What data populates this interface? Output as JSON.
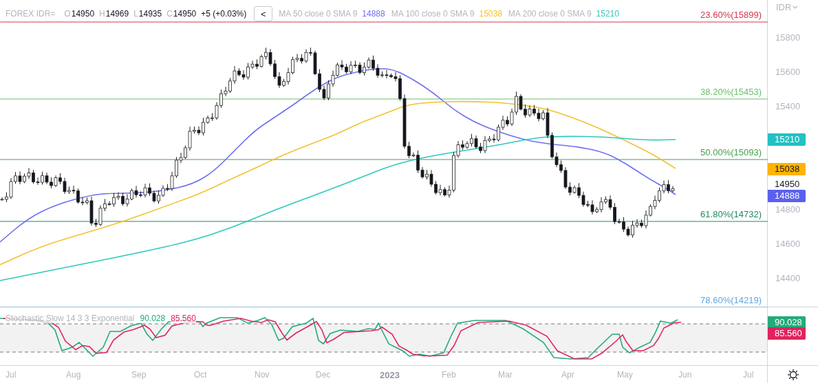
{
  "header": {
    "symbol": "FOREX IDR=",
    "ohlc": [
      {
        "label": "O",
        "value": "14950"
      },
      {
        "label": "H",
        "value": "14969"
      },
      {
        "label": "L",
        "value": "14935"
      },
      {
        "label": "C",
        "value": "14950"
      }
    ],
    "change": "+5 (+0.03%)",
    "collapse_button": "<"
  },
  "moving_averages": [
    {
      "label": "MA 50 close 0 SMA 9",
      "value": "14888",
      "color": "#6c6ff0"
    },
    {
      "label": "MA 100 close 0 SMA 9",
      "value": "15038",
      "color": "#f2c230"
    },
    {
      "label": "MA 200 close 0 SMA 9",
      "value": "15210",
      "color": "#2ec8c0"
    }
  ],
  "fibonacci_levels": [
    {
      "label": "23.60%(15899)",
      "color": "#d2364f"
    },
    {
      "label": "38.20%(15453)",
      "color": "#6abf69"
    },
    {
      "label": "50.00%(15093)",
      "color": "#43a047"
    },
    {
      "label": "61.80%(14732)",
      "color": "#1e8a5f"
    },
    {
      "label": "78.60%(14219)",
      "color": "#64a6e0"
    }
  ],
  "price_axis": {
    "currency": "IDR",
    "ticks": [
      "15800",
      "15600",
      "15400",
      "14800",
      "14600",
      "14400"
    ],
    "last_price": "14950",
    "badges": [
      {
        "value": "15210",
        "color": "#22c1c3"
      },
      {
        "value": "15038",
        "color": "#ffb300"
      },
      {
        "value": "14888",
        "color": "#5b5ff0"
      }
    ]
  },
  "stochastic": {
    "label": "Stochastic Slow 14 3 3 Exponential",
    "lines": [
      {
        "value": "90.028",
        "color": "#22ab7a"
      },
      {
        "value": "85.560",
        "color": "#e0245e"
      }
    ],
    "axis_badges": [
      {
        "value": "90.028",
        "color": "#22ab7a"
      },
      {
        "value": "85.560",
        "color": "#e0245e"
      }
    ]
  },
  "time_axis": [
    {
      "label": "Jul",
      "kind": "month"
    },
    {
      "label": "Aug",
      "kind": "month"
    },
    {
      "label": "Sep",
      "kind": "month"
    },
    {
      "label": "Oct",
      "kind": "month"
    },
    {
      "label": "Nov",
      "kind": "month"
    },
    {
      "label": "Dec",
      "kind": "month"
    },
    {
      "label": "2023",
      "kind": "year"
    },
    {
      "label": "Feb",
      "kind": "month"
    },
    {
      "label": "Mar",
      "kind": "month"
    },
    {
      "label": "Apr",
      "kind": "month"
    },
    {
      "label": "May",
      "kind": "month"
    },
    {
      "label": "Jun",
      "kind": "month"
    },
    {
      "label": "Jul",
      "kind": "month"
    }
  ]
}
